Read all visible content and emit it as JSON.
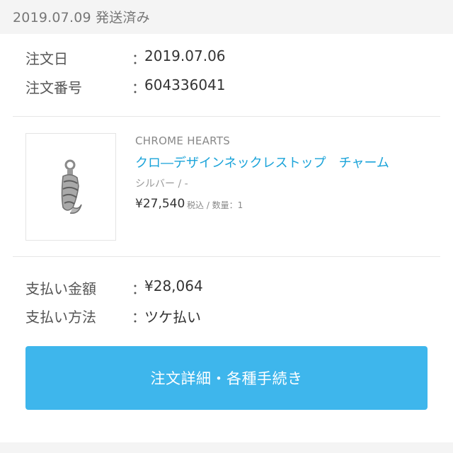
{
  "header": {
    "date": "2019.07.09",
    "status": "発送済み"
  },
  "order_info": {
    "order_date_label": "注文日",
    "order_date_value": "2019.07.06",
    "order_number_label": "注文番号",
    "order_number_value": "604336041",
    "separator": "："
  },
  "product": {
    "brand": "CHROME HEARTS",
    "name": "クロ―デザインネックレストップ　チャーム",
    "variant": "シルバー / -",
    "price": "¥27,540",
    "price_meta": "税込 / 数量：1",
    "image_icon": "pendant-charm-image"
  },
  "payment": {
    "amount_label": "支払い金額",
    "amount_value": "¥28,064",
    "method_label": "支払い方法",
    "method_value": "ツケ払い"
  },
  "cta": {
    "label": "注文詳細・各種手続き",
    "color": "#3eb6ec"
  },
  "colors": {
    "link": "#1aa3d9",
    "background": "#f4f4f4"
  }
}
